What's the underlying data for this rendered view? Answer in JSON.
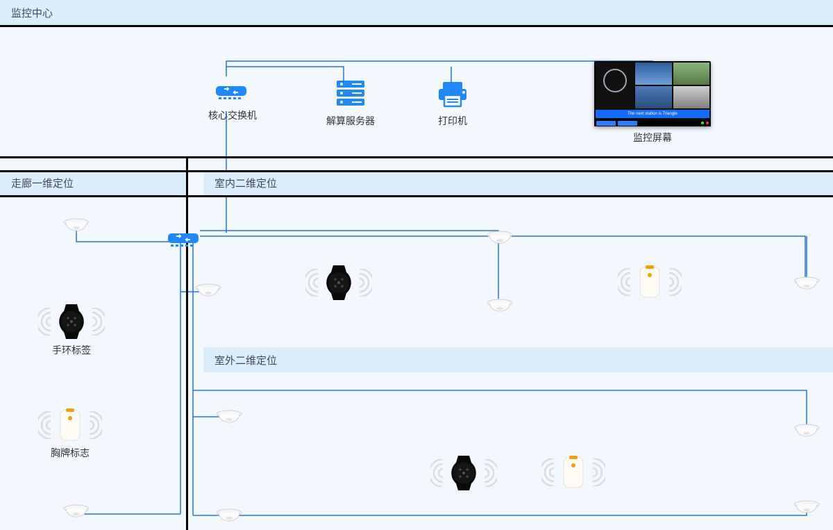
{
  "sections": {
    "monitoring_center": "监控中心",
    "corridor_1d": "走廊一维定位",
    "indoor_2d": "室内二维定位",
    "outdoor_2d": "室外二维定位"
  },
  "devices": {
    "core_switch": "核心交换机",
    "solver_server": "解算服务器",
    "printer": "打印机",
    "monitor_screen": "监控屏幕",
    "bracelet_tag": "手环标签",
    "badge_tag": "胸牌标志"
  },
  "screen_status": "The next station is Triangle"
}
